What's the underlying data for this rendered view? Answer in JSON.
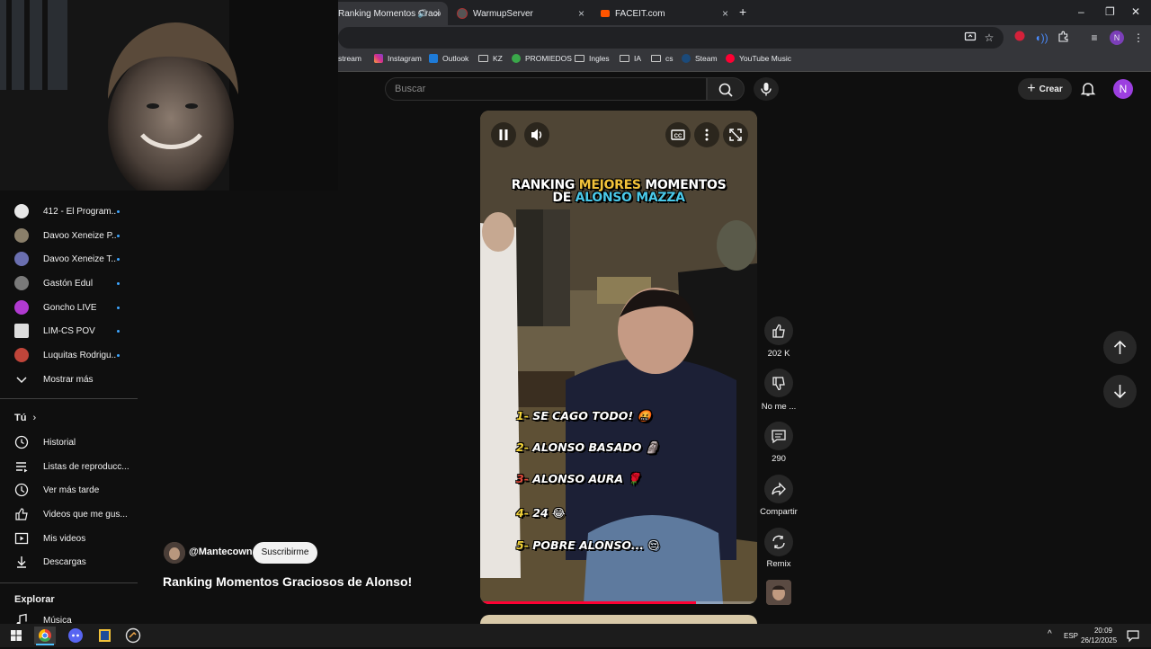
{
  "browser": {
    "tabs": [
      {
        "title": "Ranking Momentos Graciosos",
        "active": true
      },
      {
        "title": "WarmupServer",
        "active": false
      },
      {
        "title": "FACEIT.com",
        "active": false
      }
    ],
    "new_tab": "+",
    "window_controls": [
      "–",
      "❐",
      "✕"
    ],
    "bookmarks": [
      {
        "label": "stream",
        "icon": "globe-icon"
      },
      {
        "label": "Instagram",
        "icon": "instagram-icon"
      },
      {
        "label": "Outlook",
        "icon": "outlook-icon"
      },
      {
        "label": "KZ",
        "icon": "folder-icon"
      },
      {
        "label": "PROMIEDOS",
        "icon": "promiedos-icon"
      },
      {
        "label": "Ingles",
        "icon": "folder-icon"
      },
      {
        "label": "IA",
        "icon": "folder-icon"
      },
      {
        "label": "cs",
        "icon": "folder-icon"
      },
      {
        "label": "Steam",
        "icon": "steam-icon"
      },
      {
        "label": "YouTube Music",
        "icon": "youtube-music-icon"
      }
    ],
    "profile_initial": "N"
  },
  "header": {
    "search_placeholder": "Buscar",
    "create_label": "Crear",
    "avatar_initial": "N"
  },
  "sidebar": {
    "subscriptions": [
      {
        "name": "412 - El Program...",
        "color": "#e8e8e8"
      },
      {
        "name": "Davoo Xeneize P...",
        "color": "#8a7f6a"
      },
      {
        "name": "Davoo Xeneize T...",
        "color": "#6a6fb0"
      },
      {
        "name": "Gastón Edul",
        "color": "#7a7a7a"
      },
      {
        "name": "Goncho LIVE",
        "color": "#b03ad0"
      },
      {
        "name": "LIM-CS POV",
        "color": "#dddddd"
      },
      {
        "name": "Luquitas Rodrigu...",
        "color": "#c0453a"
      }
    ],
    "show_more": "Mostrar más",
    "you_section": "Tú",
    "you_items": [
      {
        "label": "Historial",
        "icon": "history-icon"
      },
      {
        "label": "Listas de reproducc...",
        "icon": "playlists-icon"
      },
      {
        "label": "Ver más tarde",
        "icon": "watch-later-icon"
      },
      {
        "label": "Videos que me gus...",
        "icon": "liked-videos-icon"
      },
      {
        "label": "Mis videos",
        "icon": "my-videos-icon"
      },
      {
        "label": "Descargas",
        "icon": "downloads-icon"
      }
    ],
    "explore_section": "Explorar",
    "explore_items": [
      {
        "label": "Música",
        "icon": "music-icon"
      }
    ]
  },
  "video": {
    "overlay_title_line1_a": "RANKING ",
    "overlay_title_line1_b": "MEJORES",
    "overlay_title_line1_c": " MOMENTOS",
    "overlay_title_line2_a": "DE ",
    "overlay_title_line2_b": "ALONSO MAZZA",
    "rankings": [
      {
        "num": "1-",
        "text": "SE CAGO TODO!"
      },
      {
        "num": "2-",
        "text": "ALONSO BASADO"
      },
      {
        "num": "3-",
        "text": "ALONSO AURA"
      },
      {
        "num": "4-",
        "text": "24"
      },
      {
        "num": "5-",
        "text": "POBRE ALONSO..."
      }
    ],
    "progress": 0.78
  },
  "actions": {
    "likes": "202 K",
    "dislike": "No me ...",
    "comments": "290",
    "share": "Compartir",
    "remix": "Remix"
  },
  "channel": {
    "handle": "@Mantecown",
    "subscribe": "Suscribirme",
    "title": "Ranking Momentos Graciosos de Alonso!"
  },
  "taskbar": {
    "lang": "ESP",
    "time": "20:09",
    "date": "26/12/2025"
  }
}
